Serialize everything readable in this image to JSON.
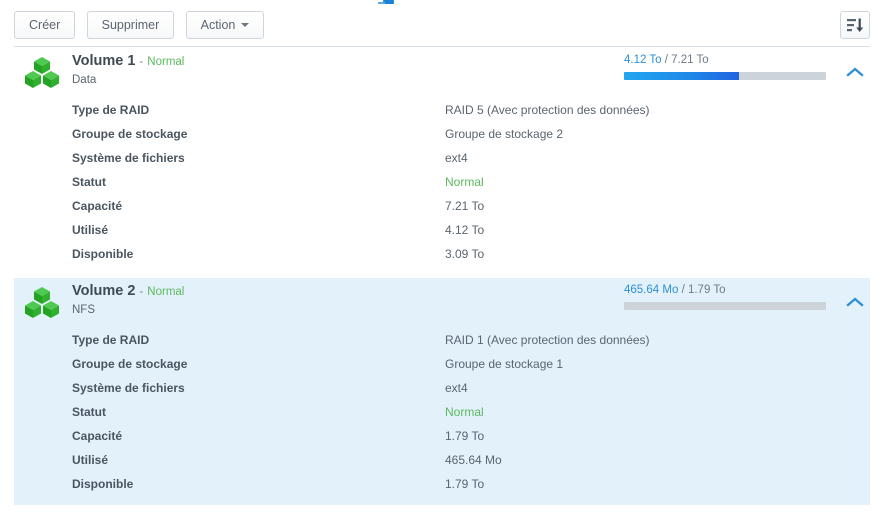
{
  "toolbar": {
    "create_label": "Créer",
    "delete_label": "Supprimer",
    "action_label": "Action",
    "sort_icon": "sort-descending-icon"
  },
  "colors": {
    "accent": "#2d8fd5",
    "status_ok": "#5cb85c",
    "panel_selected_bg": "#e3f1fb",
    "bar_track": "#ccd4da",
    "bar_fill_start": "#22a6ef",
    "bar_fill_end": "#1f62e0",
    "volume_icon": "#2fb02f"
  },
  "detail_labels": {
    "raid_type": "Type de RAID",
    "storage_group": "Groupe de stockage",
    "file_system": "Système de fichiers",
    "status": "Statut",
    "capacity": "Capacité",
    "used": "Utilisé",
    "available": "Disponible"
  },
  "volumes": [
    {
      "name": "Volume 1",
      "separator": "-",
      "state": "Normal",
      "subtitle": "Data",
      "usage_used": "4.12 To",
      "usage_divider": "/",
      "usage_total": "7.21 To",
      "usage_percent": 57,
      "collapse_icon": "chevron-up-icon",
      "icon": "volume-cubes-icon",
      "details": {
        "raid_type": "RAID 5 (Avec protection des données)",
        "storage_group": "Groupe de stockage 2",
        "file_system": "ext4",
        "status": "Normal",
        "capacity": "7.21 To",
        "used": "4.12 To",
        "available": "3.09 To"
      }
    },
    {
      "name": "Volume 2",
      "separator": "-",
      "state": "Normal",
      "subtitle": "NFS",
      "usage_used": "465.64 Mo",
      "usage_divider": "/",
      "usage_total": "1.79 To",
      "usage_percent": 0,
      "collapse_icon": "chevron-up-icon",
      "icon": "volume-cubes-icon",
      "details": {
        "raid_type": "RAID 1 (Avec protection des données)",
        "storage_group": "Groupe de stockage 1",
        "file_system": "ext4",
        "status": "Normal",
        "capacity": "1.79 To",
        "used": "465.64 Mo",
        "available": "1.79 To"
      }
    }
  ]
}
